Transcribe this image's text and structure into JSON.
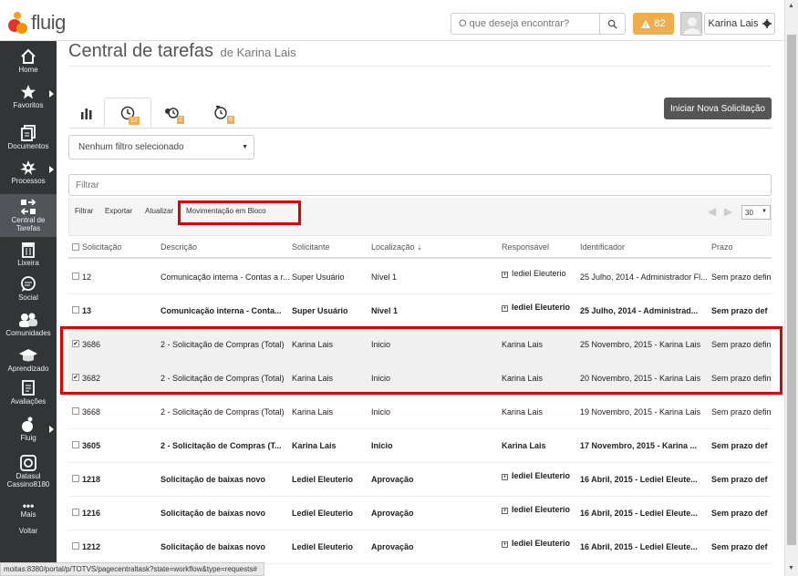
{
  "header": {
    "logo_text": "fluig",
    "search_placeholder": "O que deseja encontrar?",
    "alert_count": "82",
    "user_name": "Karina Lais"
  },
  "sidebar": {
    "items": [
      {
        "label": "Home"
      },
      {
        "label": "Favoritos"
      },
      {
        "label": "Documentos"
      },
      {
        "label": "Processos"
      },
      {
        "label": "Central de Tarefas"
      },
      {
        "label": "Lixeira"
      },
      {
        "label": "Social"
      },
      {
        "label": "Comunidades"
      },
      {
        "label": "Aprendizado"
      },
      {
        "label": "Avaliações"
      },
      {
        "label": "Fluig"
      },
      {
        "label": "Datasul Cassino8180"
      },
      {
        "label": "Mais"
      },
      {
        "label": "Voltar"
      }
    ]
  },
  "page": {
    "title": "Central de tarefas",
    "subtitle": "de Karina Lais",
    "tabs": [
      {
        "icon": "chart-icon",
        "badge": ""
      },
      {
        "icon": "clock-icon",
        "badge": "12"
      },
      {
        "icon": "group-clock-icon",
        "badge": "2"
      },
      {
        "icon": "clock-alert-icon",
        "badge": "6"
      }
    ],
    "new_request_button": "Iniciar Nova Solicitação",
    "filter_select": "Nenhum filtro selecionado",
    "filter_placeholder": "Filtrar",
    "toolbar": {
      "filter": "Filtrar",
      "export": "Exportar",
      "refresh": "Atualizar",
      "bulk_move": "Movimentação em Bloco",
      "per_page": "30"
    }
  },
  "table": {
    "columns": [
      "Solicitação",
      "Descrição",
      "Solicitante",
      "Localização",
      "Responsável",
      "Identificador",
      "Prazo"
    ],
    "rows": [
      {
        "id": "12",
        "desc": "Comunicação interna - Contas a r...",
        "requester": "Super Usuário",
        "location": "Nível 1",
        "responsible": "Iediel Eleuterio",
        "identifier": "25 Julho, 2014 - Administrador Fl...",
        "deadline": "Sem prazo defin",
        "checked": false,
        "bold": false,
        "group": true
      },
      {
        "id": "13",
        "desc": "Comunicação interna - Conta...",
        "requester": "Super Usuário",
        "location": "Nível 1",
        "responsible": "Iediel Eleuterio",
        "identifier": "25 Julho, 2014 - Administrad...",
        "deadline": "Sem prazo def",
        "checked": false,
        "bold": true,
        "group": true
      },
      {
        "id": "3686",
        "desc": "2 - Solicitação de Compras (Total)",
        "requester": "Karina Lais",
        "location": "Inicio",
        "responsible": "Karina Lais",
        "identifier": "25 Novembro, 2015 - Karina Lais",
        "deadline": "Sem prazo defin",
        "checked": true,
        "bold": false,
        "group": false
      },
      {
        "id": "3682",
        "desc": "2 - Solicitação de Compras (Total)",
        "requester": "Karina Lais",
        "location": "Inicio",
        "responsible": "Karina Lais",
        "identifier": "20 Novembro, 2015 - Karina Lais",
        "deadline": "Sem prazo defin",
        "checked": true,
        "bold": false,
        "group": false
      },
      {
        "id": "3668",
        "desc": "2 - Solicitação de Compras (Total)",
        "requester": "Karina Lais",
        "location": "Inicio",
        "responsible": "Karina Lais",
        "identifier": "19 Novembro, 2015 - Karina Lais",
        "deadline": "Sem prazo defin",
        "checked": false,
        "bold": false,
        "group": false
      },
      {
        "id": "3605",
        "desc": "2 - Solicitação de Compras (T...",
        "requester": "Karina Lais",
        "location": "Inicio",
        "responsible": "Karina Lais",
        "identifier": "17 Novembro, 2015 - Karina ...",
        "deadline": "Sem prazo def",
        "checked": false,
        "bold": true,
        "group": false
      },
      {
        "id": "1218",
        "desc": "Solicitação de baixas novo",
        "requester": "Lediel Eleuterio",
        "location": "Aprovação",
        "responsible": "Iediel Eleuterio",
        "identifier": "16 Abril, 2015 - Lediel Eleute...",
        "deadline": "Sem prazo def",
        "checked": false,
        "bold": true,
        "group": true
      },
      {
        "id": "1216",
        "desc": "Solicitação de baixas novo",
        "requester": "Lediel Eleuterio",
        "location": "Aprovação",
        "responsible": "Iediel Eleuterio",
        "identifier": "16 Abril, 2015 - Lediel Eleute...",
        "deadline": "Sem prazo def",
        "checked": false,
        "bold": true,
        "group": true
      },
      {
        "id": "1212",
        "desc": "Solicitação de baixas novo",
        "requester": "Lediel Eleuterio",
        "location": "Aprovação",
        "responsible": "Iediel Eleuterio",
        "identifier": "16 Abril, 2015 - Lediel Eleute...",
        "deadline": "Sem prazo def",
        "checked": false,
        "bold": true,
        "group": true
      }
    ]
  },
  "status_url": "moitas:8380/portal/p/TOTVS/pagecentraltask?state=workflow&type=requests#",
  "colors": {
    "sidebar": "#333436",
    "accent": "#f0ad4e",
    "annotation": "#e00000",
    "dark_button": "#555555"
  }
}
